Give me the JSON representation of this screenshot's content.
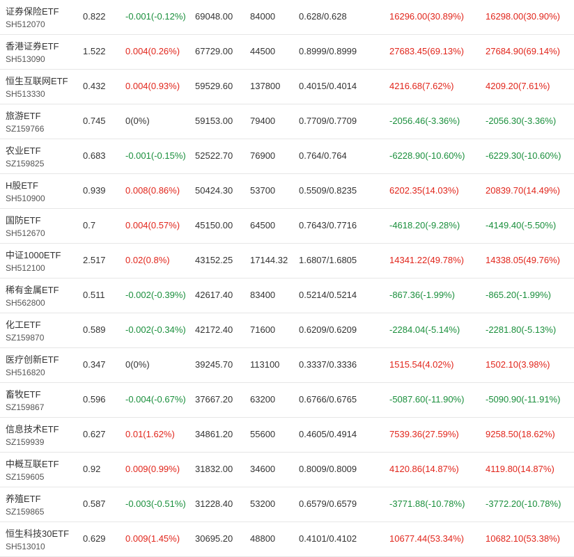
{
  "colors": {
    "up": "#e1251b",
    "down": "#1a8f3c",
    "flat": "#333333"
  },
  "rows": [
    {
      "name": "证券保险ETF",
      "code": "SH512070",
      "price": "0.822",
      "change": "-0.001(-0.12%)",
      "change_dir": "down",
      "value": "69048.00",
      "shares": "84000",
      "cost": "0.628/0.628",
      "pl1": "16296.00(30.89%)",
      "pl1_dir": "up",
      "pl2": "16298.00(30.90%)",
      "pl2_dir": "up"
    },
    {
      "name": "香港证券ETF",
      "code": "SH513090",
      "price": "1.522",
      "change": "0.004(0.26%)",
      "change_dir": "up",
      "value": "67729.00",
      "shares": "44500",
      "cost": "0.8999/0.8999",
      "pl1": "27683.45(69.13%)",
      "pl1_dir": "up",
      "pl2": "27684.90(69.14%)",
      "pl2_dir": "up"
    },
    {
      "name": "恒生互联网ETF",
      "code": "SH513330",
      "price": "0.432",
      "change": "0.004(0.93%)",
      "change_dir": "up",
      "value": "59529.60",
      "shares": "137800",
      "cost": "0.4015/0.4014",
      "pl1": "4216.68(7.62%)",
      "pl1_dir": "up",
      "pl2": "4209.20(7.61%)",
      "pl2_dir": "up"
    },
    {
      "name": "旅游ETF",
      "code": "SZ159766",
      "price": "0.745",
      "change": "0(0%)",
      "change_dir": "flat",
      "value": "59153.00",
      "shares": "79400",
      "cost": "0.7709/0.7709",
      "pl1": "-2056.46(-3.36%)",
      "pl1_dir": "down",
      "pl2": "-2056.30(-3.36%)",
      "pl2_dir": "down"
    },
    {
      "name": "农业ETF",
      "code": "SZ159825",
      "price": "0.683",
      "change": "-0.001(-0.15%)",
      "change_dir": "down",
      "value": "52522.70",
      "shares": "76900",
      "cost": "0.764/0.764",
      "pl1": "-6228.90(-10.60%)",
      "pl1_dir": "down",
      "pl2": "-6229.30(-10.60%)",
      "pl2_dir": "down"
    },
    {
      "name": "H股ETF",
      "code": "SH510900",
      "price": "0.939",
      "change": "0.008(0.86%)",
      "change_dir": "up",
      "value": "50424.30",
      "shares": "53700",
      "cost": "0.5509/0.8235",
      "pl1": "6202.35(14.03%)",
      "pl1_dir": "up",
      "pl2": "20839.70(14.49%)",
      "pl2_dir": "up"
    },
    {
      "name": "国防ETF",
      "code": "SH512670",
      "price": "0.7",
      "change": "0.004(0.57%)",
      "change_dir": "up",
      "value": "45150.00",
      "shares": "64500",
      "cost": "0.7643/0.7716",
      "pl1": "-4618.20(-9.28%)",
      "pl1_dir": "down",
      "pl2": "-4149.40(-5.50%)",
      "pl2_dir": "down"
    },
    {
      "name": "中证1000ETF",
      "code": "SH512100",
      "price": "2.517",
      "change": "0.02(0.8%)",
      "change_dir": "up",
      "value": "43152.25",
      "shares": "17144.32",
      "cost": "1.6807/1.6805",
      "pl1": "14341.22(49.78%)",
      "pl1_dir": "up",
      "pl2": "14338.05(49.76%)",
      "pl2_dir": "up"
    },
    {
      "name": "稀有金属ETF",
      "code": "SH562800",
      "price": "0.511",
      "change": "-0.002(-0.39%)",
      "change_dir": "down",
      "value": "42617.40",
      "shares": "83400",
      "cost": "0.5214/0.5214",
      "pl1": "-867.36(-1.99%)",
      "pl1_dir": "down",
      "pl2": "-865.20(-1.99%)",
      "pl2_dir": "down"
    },
    {
      "name": "化工ETF",
      "code": "SZ159870",
      "price": "0.589",
      "change": "-0.002(-0.34%)",
      "change_dir": "down",
      "value": "42172.40",
      "shares": "71600",
      "cost": "0.6209/0.6209",
      "pl1": "-2284.04(-5.14%)",
      "pl1_dir": "down",
      "pl2": "-2281.80(-5.13%)",
      "pl2_dir": "down"
    },
    {
      "name": "医疗创新ETF",
      "code": "SH516820",
      "price": "0.347",
      "change": "0(0%)",
      "change_dir": "flat",
      "value": "39245.70",
      "shares": "113100",
      "cost": "0.3337/0.3336",
      "pl1": "1515.54(4.02%)",
      "pl1_dir": "up",
      "pl2": "1502.10(3.98%)",
      "pl2_dir": "up"
    },
    {
      "name": "畜牧ETF",
      "code": "SZ159867",
      "price": "0.596",
      "change": "-0.004(-0.67%)",
      "change_dir": "down",
      "value": "37667.20",
      "shares": "63200",
      "cost": "0.6766/0.6765",
      "pl1": "-5087.60(-11.90%)",
      "pl1_dir": "down",
      "pl2": "-5090.90(-11.91%)",
      "pl2_dir": "down"
    },
    {
      "name": "信息技术ETF",
      "code": "SZ159939",
      "price": "0.627",
      "change": "0.01(1.62%)",
      "change_dir": "up",
      "value": "34861.20",
      "shares": "55600",
      "cost": "0.4605/0.4914",
      "pl1": "7539.36(27.59%)",
      "pl1_dir": "up",
      "pl2": "9258.50(18.62%)",
      "pl2_dir": "up"
    },
    {
      "name": "中概互联ETF",
      "code": "SZ159605",
      "price": "0.92",
      "change": "0.009(0.99%)",
      "change_dir": "up",
      "value": "31832.00",
      "shares": "34600",
      "cost": "0.8009/0.8009",
      "pl1": "4120.86(14.87%)",
      "pl1_dir": "up",
      "pl2": "4119.80(14.87%)",
      "pl2_dir": "up"
    },
    {
      "name": "养殖ETF",
      "code": "SZ159865",
      "price": "0.587",
      "change": "-0.003(-0.51%)",
      "change_dir": "down",
      "value": "31228.40",
      "shares": "53200",
      "cost": "0.6579/0.6579",
      "pl1": "-3771.88(-10.78%)",
      "pl1_dir": "down",
      "pl2": "-3772.20(-10.78%)",
      "pl2_dir": "down"
    },
    {
      "name": "恒生科技30ETF",
      "code": "SH513010",
      "price": "0.629",
      "change": "0.009(1.45%)",
      "change_dir": "up",
      "value": "30695.20",
      "shares": "48800",
      "cost": "0.4101/0.4102",
      "pl1": "10677.44(53.34%)",
      "pl1_dir": "up",
      "pl2": "10682.10(53.38%)",
      "pl2_dir": "up"
    }
  ]
}
